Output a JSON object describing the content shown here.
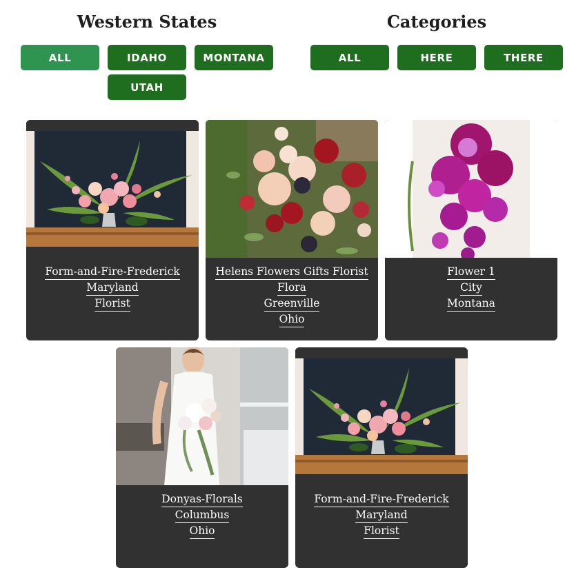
{
  "filters": {
    "states": {
      "title": "Western States",
      "buttons": [
        {
          "label": "ALL",
          "active": true
        },
        {
          "label": "IDAHO",
          "active": false
        },
        {
          "label": "MONTANA",
          "active": false
        },
        {
          "label": "UTAH",
          "active": false
        }
      ]
    },
    "categories": {
      "title": "Categories",
      "buttons": [
        {
          "label": "ALL",
          "active": false
        },
        {
          "label": "HERE",
          "active": false
        },
        {
          "label": "THERE",
          "active": false
        }
      ]
    }
  },
  "colors": {
    "button_green": "#1f6e1f",
    "button_active_green": "#2e9450",
    "card_dark": "#313131"
  },
  "cards": [
    {
      "lines": [
        "Form-and-Fire-Frederick",
        "Maryland",
        "Florist"
      ]
    },
    {
      "lines": [
        "Helens Flowers Gifts Florist",
        "Flora",
        "Greenville",
        "Ohio"
      ]
    },
    {
      "lines": [
        "Flower 1",
        "City",
        "Montana"
      ]
    },
    {
      "lines": [
        "Donyas-Florals",
        "Columbus",
        "Ohio"
      ]
    },
    {
      "lines": [
        "Form-and-Fire-Frederick",
        "Maryland",
        "Florist"
      ]
    }
  ]
}
